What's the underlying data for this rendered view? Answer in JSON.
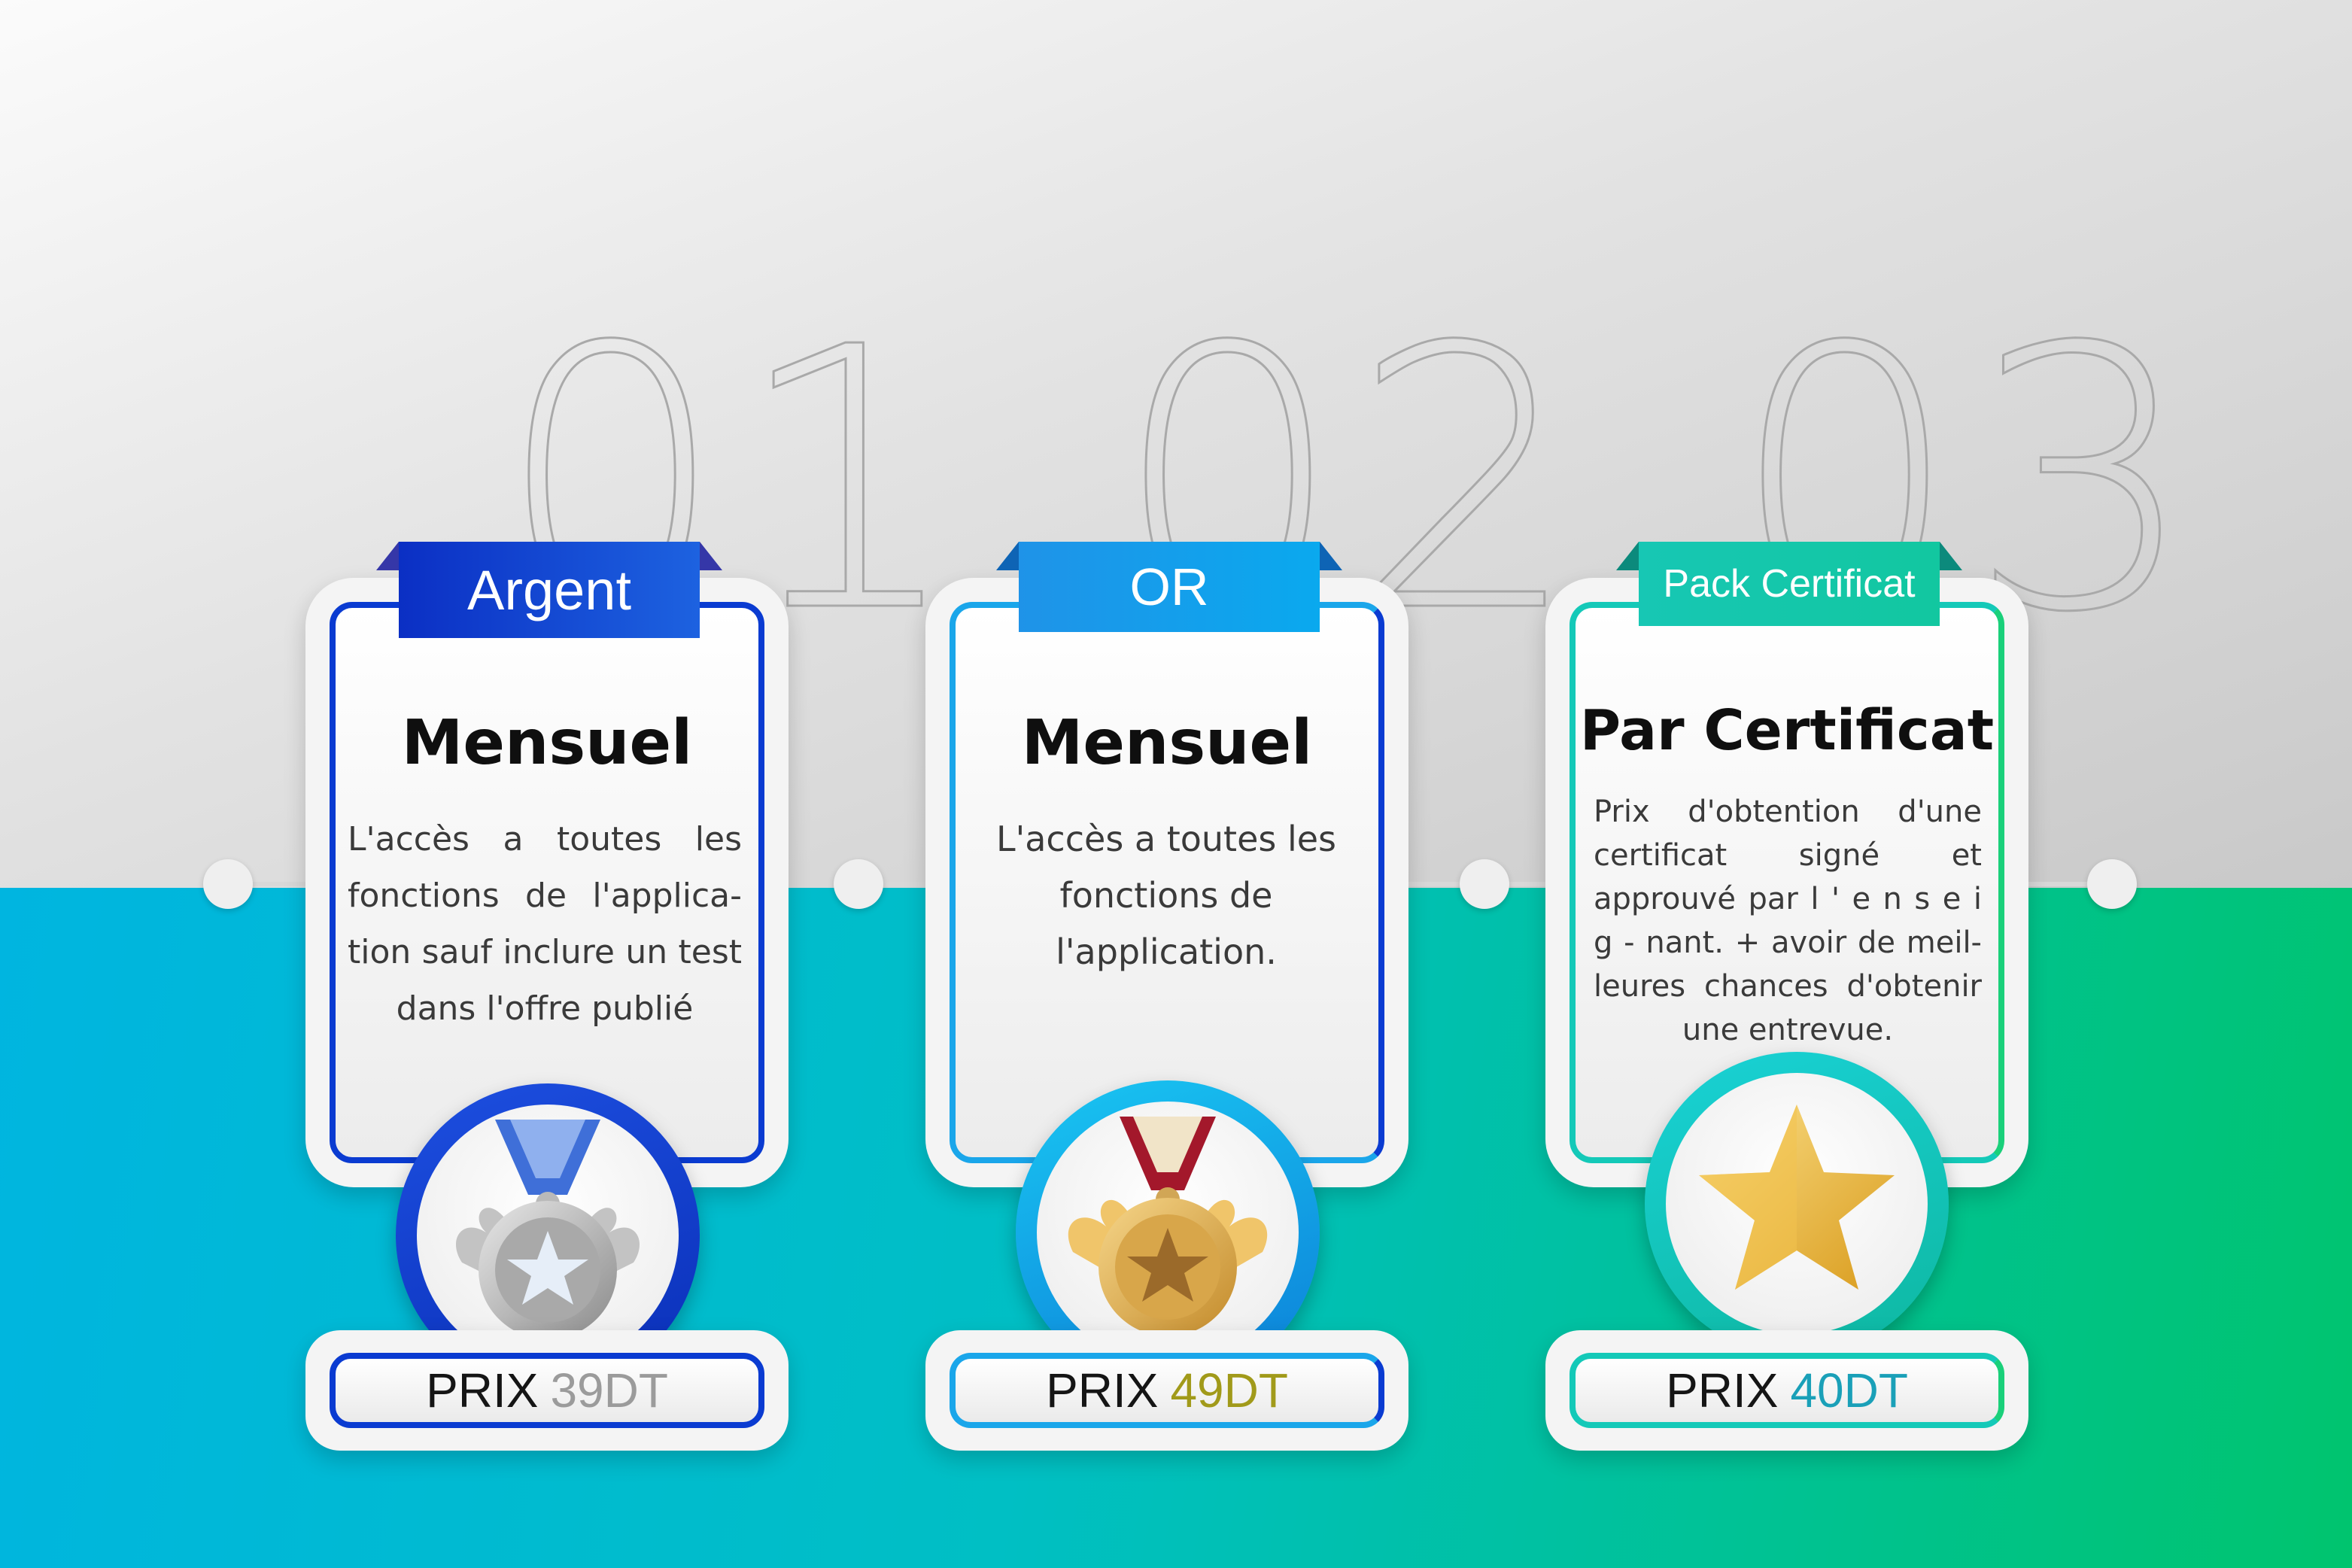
{
  "steps": [
    {
      "number": "01",
      "ribbon": "Argent",
      "title": "Mensuel",
      "description": "L'accès a toutes les fonctions de l'applica- tion sauf inclure un test dans l'offre publié",
      "price_label": "PRIX",
      "price_value": "39DT",
      "icon": "silver-medal-icon",
      "accent": "#0a3bd1"
    },
    {
      "number": "02",
      "ribbon": "OR",
      "title": "Mensuel",
      "description": "L'accès a toutes les fonctions de l'application.",
      "price_label": "PRIX",
      "price_value": "49DT",
      "icon": "gold-medal-icon",
      "accent": "#1aa6ea"
    },
    {
      "number": "03",
      "ribbon": "Pack Certificat",
      "title": "Par Certificat",
      "description": "Prix d'obtention d'une certificat signé et approuvé par l ' e n s e i g - nant. + avoir de meil- leures chances d'obtenir une entrevue.",
      "price_label": "PRIX",
      "price_value": "40DT",
      "icon": "gold-star-icon",
      "accent": "#14c9b8"
    }
  ],
  "colors": {
    "price_silver": "#9b9b9b",
    "price_gold": "#a19a1a",
    "price_teal": "#1aa0b8"
  }
}
